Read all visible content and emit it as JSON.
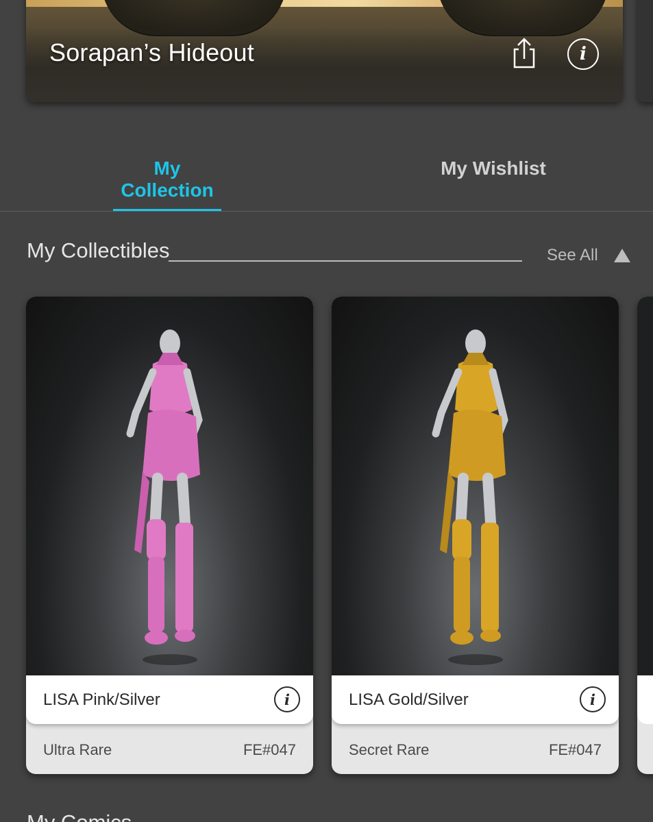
{
  "hideout": {
    "title": "Sorapan’s Hideout",
    "share_icon": "share-icon",
    "info_icon": "info-icon"
  },
  "tabs": [
    {
      "label": "My Collection",
      "active": true
    },
    {
      "label": "My Wishlist",
      "active": false
    }
  ],
  "colors": {
    "accent": "#1ec5e8",
    "background": "#424242",
    "pink_figure": "#e07ac4",
    "gold_figure": "#d9a526"
  },
  "collectibles": {
    "title": "My Collectibles",
    "see_all": "See All",
    "collapse_icon": "triangle-up-icon",
    "items": [
      {
        "name": "LISA Pink/Silver",
        "rarity": "Ultra Rare",
        "serial": "FE#047",
        "color": "#e07ac4"
      },
      {
        "name": "LISA Gold/Silver",
        "rarity": "Secret Rare",
        "serial": "FE#047",
        "color": "#d9a526"
      }
    ]
  },
  "next_section": {
    "title": "My Comics"
  }
}
